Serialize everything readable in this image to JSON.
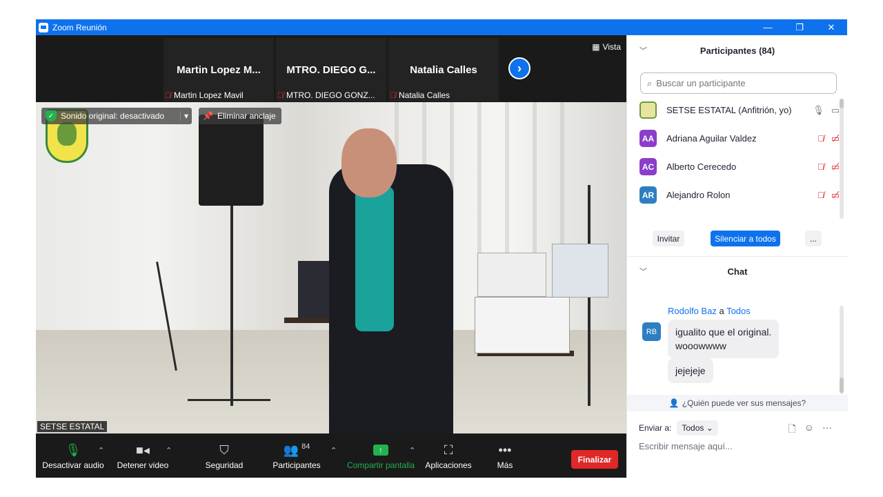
{
  "window": {
    "title": "Zoom Reunión",
    "minimize": "—",
    "restore": "❐",
    "close": "✕"
  },
  "video_strip": {
    "tiles": [
      {
        "name": "Martin  Lopez  M...",
        "label": "Martin Lopez Mavil"
      },
      {
        "name": "MTRO. DIEGO G...",
        "label": "MTRO. DIEGO GONZ..."
      },
      {
        "name": "Natalia Calles",
        "label": "Natalia Calles"
      }
    ],
    "next": "›",
    "view_label": "Vista"
  },
  "main_video": {
    "overlay_original_sound": "Sonido original: desactivado",
    "overlay_unpin": "Eliminar anclaje",
    "speaker_label": "SETSE ESTATAL"
  },
  "toolbar": {
    "mute": "Desactivar audio",
    "stop_video": "Detener video",
    "security": "Seguridad",
    "participants": "Participantes",
    "participants_count": "84",
    "share": "Compartir pantalla",
    "apps": "Aplicaciones",
    "more": "Más",
    "end": "Finalizar"
  },
  "participants_panel": {
    "title": "Participantes (84)",
    "search_placeholder": "Buscar un participante",
    "list": [
      {
        "initials": "",
        "name": "SETSE ESTATAL (Anfitrión, yo)",
        "color": "#e8e4a0",
        "muted": false
      },
      {
        "initials": "AA",
        "name": "Adriana Aguilar Valdez",
        "color": "#8a3ec9",
        "muted": true
      },
      {
        "initials": "AC",
        "name": "Alberto Cerecedo",
        "color": "#8a3ec9",
        "muted": true
      },
      {
        "initials": "AR",
        "name": "Alejandro Rolon",
        "color": "#2d7fc1",
        "muted": true
      }
    ],
    "invite": "Invitar",
    "mute_all": "Silenciar a todos",
    "more": "..."
  },
  "chat_panel": {
    "title": "Chat",
    "sender": "Rodolfo Baz",
    "to_word": "a",
    "recipient": "Todos",
    "avatar": "RB",
    "messages": [
      "igualito que el original.\nwooowwww",
      "jejejeje"
    ],
    "who_can_see": "¿Quién puede ver sus mensajes?",
    "send_to_label": "Enviar a:",
    "send_to_value": "Todos",
    "input_placeholder": "Escribir mensaje aquí..."
  }
}
